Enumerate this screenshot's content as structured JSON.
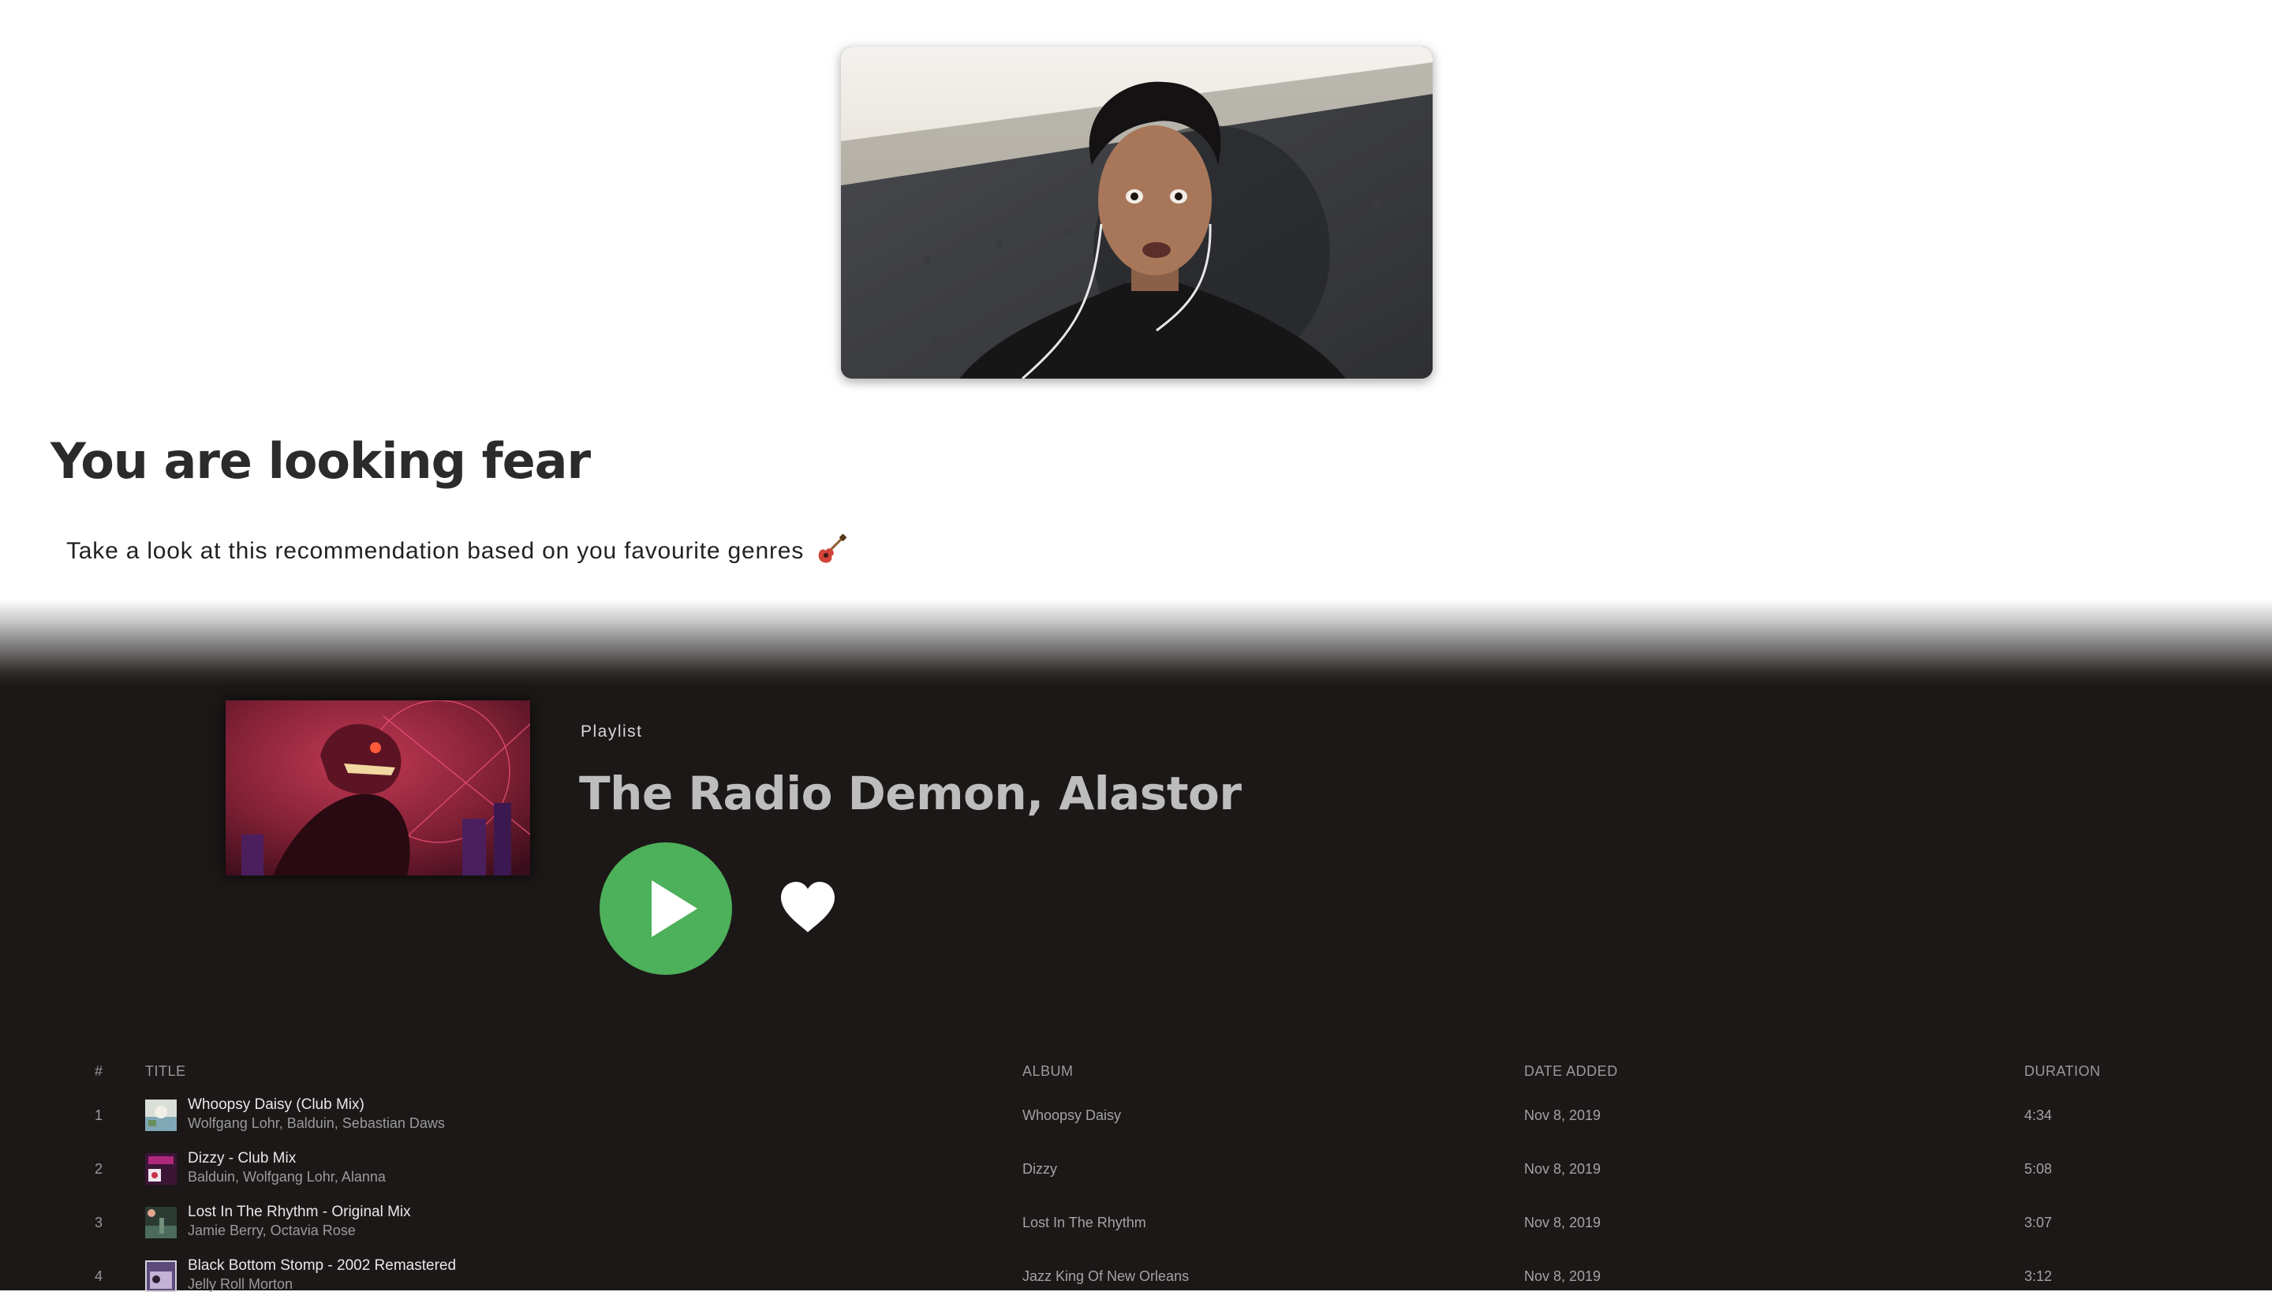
{
  "mood": {
    "heading": "You are looking fear",
    "subtitle": "Take a look at this recommendation based on you favourite genres",
    "emoji_icon": "guitar-icon"
  },
  "playlist": {
    "type_label": "Playlist",
    "title": "The Radio Demon, Alastor",
    "play_icon": "play-icon",
    "like_icon": "heart-icon",
    "accent_color": "#4db05a",
    "background_color": "#1b1817"
  },
  "table": {
    "headers": {
      "number": "#",
      "title": "TITLE",
      "album": "ALBUM",
      "date_added": "DATE ADDED",
      "duration": "DURATION"
    },
    "rows": [
      {
        "number": "1",
        "title": "Whoopsy Daisy (Club Mix)",
        "artists": "Wolfgang Lohr, Balduin, Sebastian Daws",
        "album": "Whoopsy Daisy",
        "date_added": "Nov 8, 2019",
        "duration": "4:34"
      },
      {
        "number": "2",
        "title": "Dizzy - Club Mix",
        "artists": "Balduin, Wolfgang Lohr, Alanna",
        "album": "Dizzy",
        "date_added": "Nov 8, 2019",
        "duration": "5:08"
      },
      {
        "number": "3",
        "title": "Lost In The Rhythm - Original Mix",
        "artists": "Jamie Berry, Octavia Rose",
        "album": "Lost In The Rhythm",
        "date_added": "Nov 8, 2019",
        "duration": "3:07"
      },
      {
        "number": "4",
        "title": "Black Bottom Stomp - 2002 Remastered",
        "artists": "Jelly Roll Morton",
        "album": "Jazz King Of New Orleans",
        "date_added": "Nov 8, 2019",
        "duration": "3:12"
      }
    ]
  }
}
